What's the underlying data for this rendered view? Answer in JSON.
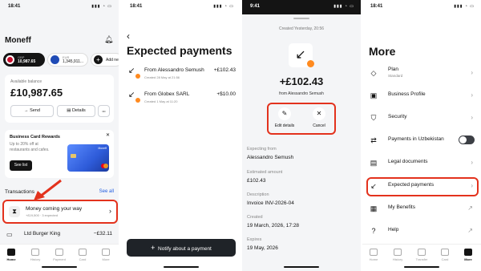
{
  "home": {
    "time": "18:41",
    "status_icons": "▮▮▮ ◔ ▭",
    "logo": "Moneff",
    "bell_icon": "bell-icon",
    "accounts": [
      {
        "currency": "GBP",
        "amount": "10,987.65"
      },
      {
        "currency": "EUR",
        "amount": "1,345,911..."
      },
      {
        "label": "Add ne"
      }
    ],
    "available_label": "Available balance",
    "balance": "£10,987.65",
    "send_label": "Send",
    "details_label": "Details",
    "more_dots": "•••",
    "promo": {
      "title": "Business Card Rewards",
      "text": "Up to 20% off at restaurants and cafes.",
      "see_list": "See list",
      "close": "✕",
      "card_brand": "Moneff"
    },
    "transactions_label": "Transactions",
    "see_all": "See all",
    "tx": [
      {
        "title": "Money coming your way",
        "sub": "+£19,500 · 3 expected"
      },
      {
        "title": "Ltd Burger King",
        "amount": "−£32.11"
      }
    ],
    "tabs": [
      "Home",
      "History",
      "Payment",
      "Card",
      "More"
    ]
  },
  "expected": {
    "time": "18:41",
    "back": "‹",
    "title": "Expected payments",
    "items": [
      {
        "from": "From Alessandro Semush",
        "date": "Created 28 May at 21:56",
        "amount": "+£102.43"
      },
      {
        "from": "From Globex SARL",
        "date": "Created 1 May at 11:20",
        "amount": "+$10.00"
      }
    ],
    "notify_label": "Notify about a payment",
    "plus": "+"
  },
  "detail": {
    "time": "9:41",
    "created": "Created Yesterday, 20:56",
    "amount": "+£102.43",
    "from_line": "from Alessandro Semush",
    "edit_label": "Edit details",
    "cancel_label": "Cancel",
    "fields": [
      {
        "label": "Expecting from",
        "value": "Alessandro Semush"
      },
      {
        "label": "Estimated amount",
        "value": "£102.43"
      },
      {
        "label": "Description",
        "value": "Invoice INV-2026-04"
      },
      {
        "label": "Created",
        "value": "19 March, 2026, 17:28"
      },
      {
        "label": "Expires",
        "value": "19 May, 2026"
      }
    ]
  },
  "more": {
    "time": "18:41",
    "title": "More",
    "items": [
      {
        "label": "Plan",
        "sub": "Standard",
        "icon": "diamond-icon",
        "glyph": "◇",
        "right": "›"
      },
      {
        "label": "Business Profile",
        "icon": "briefcase-icon",
        "glyph": "▣",
        "right": "›"
      },
      {
        "label": "Security",
        "icon": "shield-icon",
        "glyph": "⛉",
        "right": "›"
      },
      {
        "label": "Payments in Uzbekistan",
        "icon": "transfer-icon",
        "glyph": "⇄",
        "right": "toggle"
      },
      {
        "label": "Legal documents",
        "icon": "document-icon",
        "glyph": "▤",
        "right": "›"
      },
      {
        "label": "Expected payments",
        "icon": "incoming-arrow-icon",
        "glyph": "↙",
        "right": "›"
      },
      {
        "label": "My Benefits",
        "icon": "gift-icon",
        "glyph": "▦",
        "right": "↗"
      },
      {
        "label": "Help",
        "icon": "help-icon",
        "glyph": "?",
        "right": "↗"
      }
    ],
    "tabs": [
      "Home",
      "History",
      "Transfer",
      "Card",
      "More"
    ]
  },
  "colors": {
    "accent": "#e3321d",
    "dark": "#141414",
    "orange": "#ff8a1f",
    "card_blue": "#2e5bd9"
  }
}
